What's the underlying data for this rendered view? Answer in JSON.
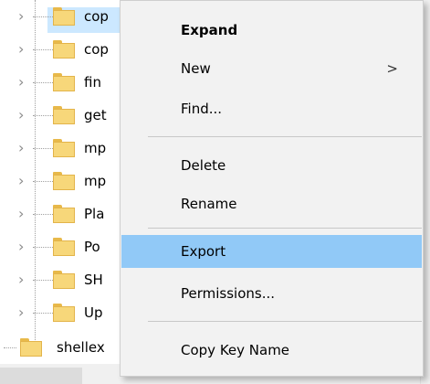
{
  "tree": {
    "items": [
      {
        "label": "cop",
        "selected": true
      },
      {
        "label": "cop"
      },
      {
        "label": "fin"
      },
      {
        "label": "get"
      },
      {
        "label": "mp"
      },
      {
        "label": "mp"
      },
      {
        "label": "Pla"
      },
      {
        "label": "Po"
      },
      {
        "label": "SH"
      },
      {
        "label": "Up"
      }
    ],
    "last": {
      "label": "shellex"
    }
  },
  "context_menu": {
    "expand": "Expand",
    "new": "New",
    "new_arrow": ">",
    "find": "Find...",
    "delete": "Delete",
    "rename": "Rename",
    "export": "Export",
    "permissions": "Permissions...",
    "copy_key_name": "Copy Key Name"
  },
  "colors": {
    "menu_bg": "#f2f2f2",
    "hover": "#91c9f7",
    "selection": "#cce8ff",
    "folder": "#f7d77a"
  }
}
